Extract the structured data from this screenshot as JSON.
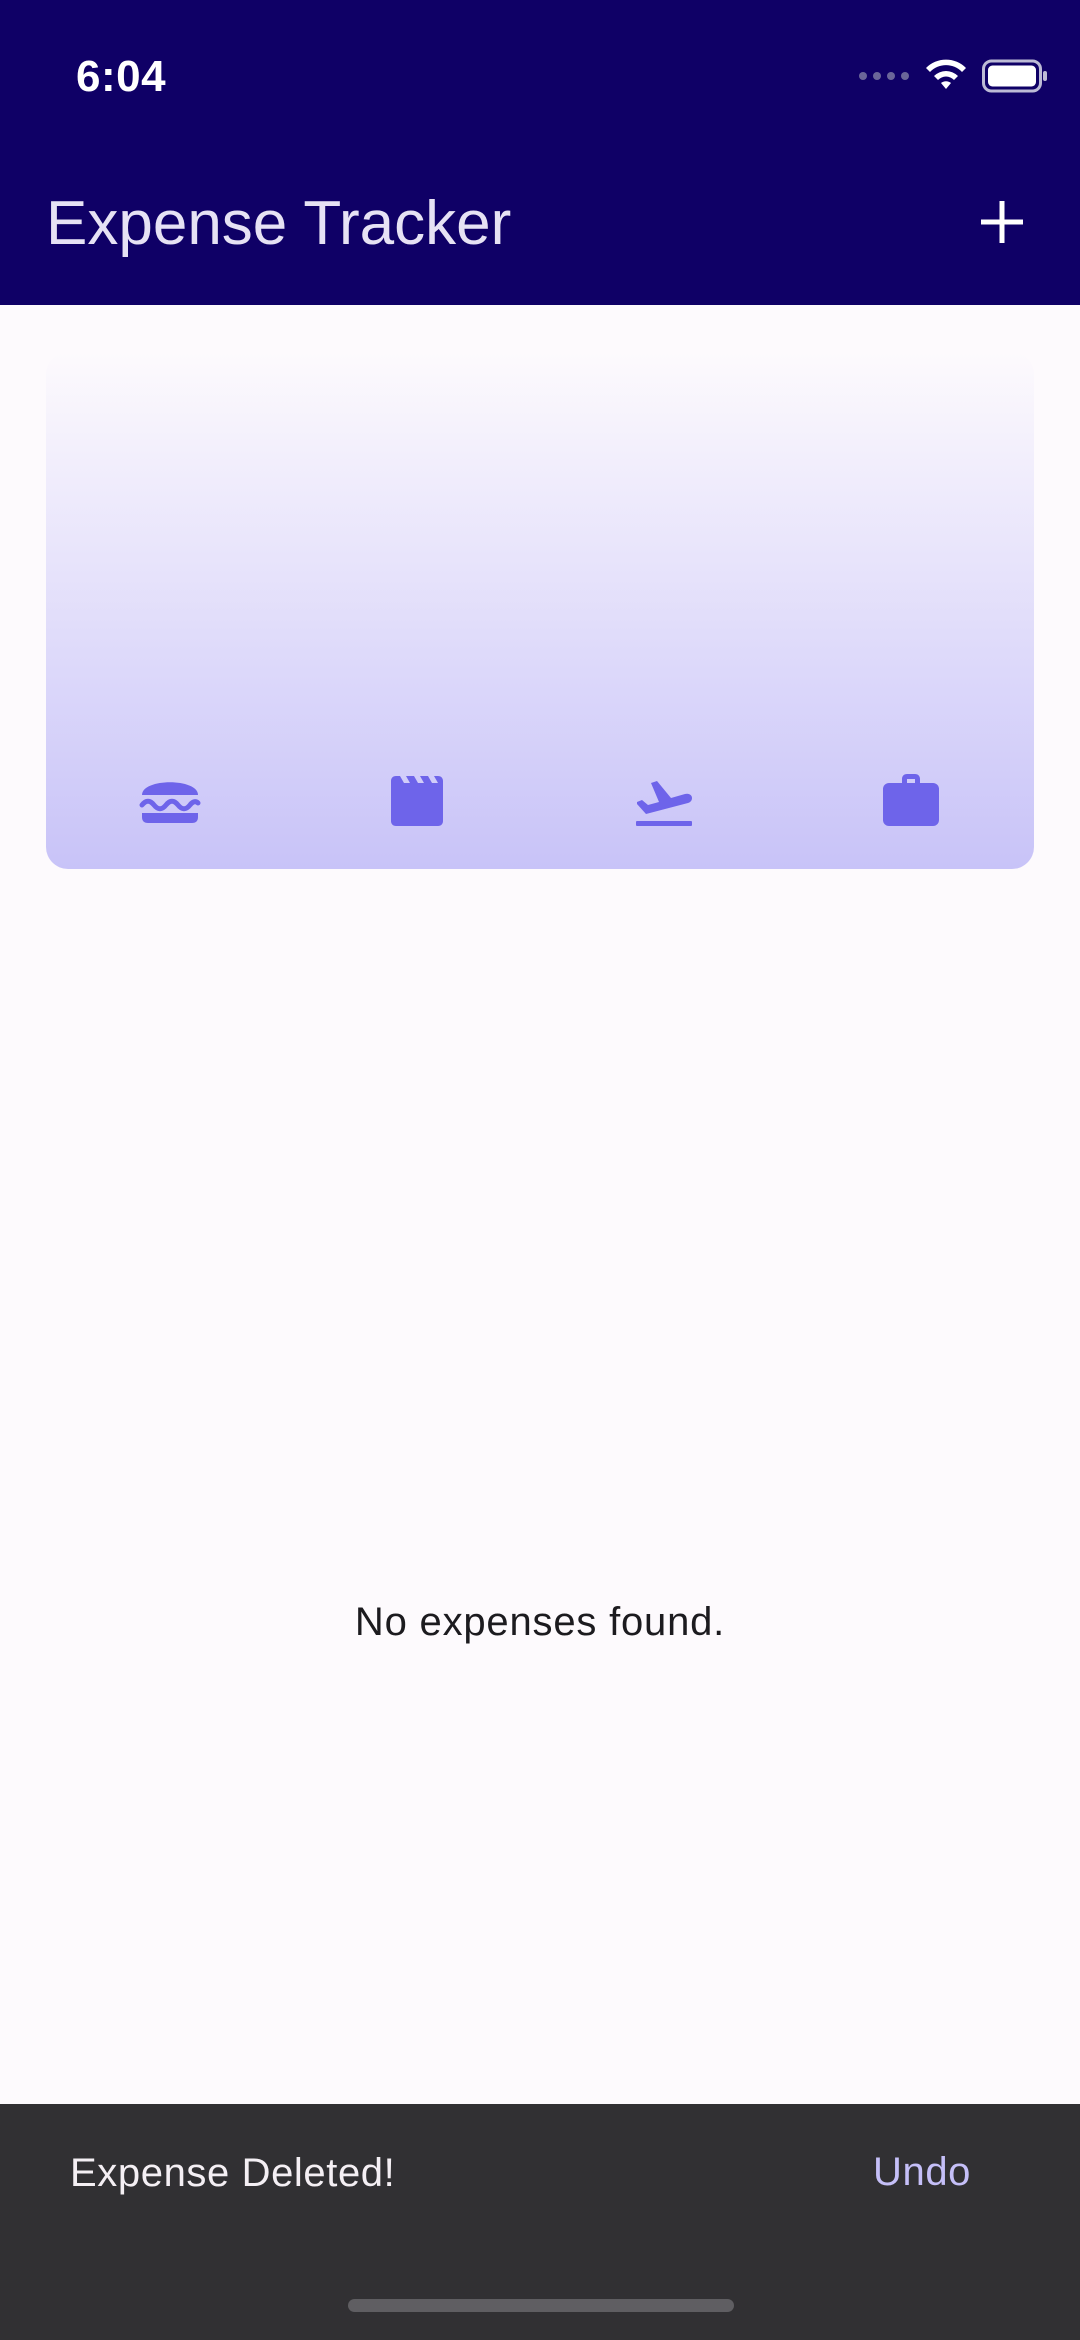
{
  "status_bar": {
    "time": "6:04",
    "icons": [
      "cellular-signal-icon",
      "wifi-icon",
      "battery-icon"
    ]
  },
  "app_bar": {
    "title": "Expense Tracker",
    "action_icon": "add-icon"
  },
  "chart": {
    "categories": [
      "food",
      "leisure",
      "travel",
      "work"
    ],
    "category_icons": [
      "burger-icon",
      "movie-clapper-icon",
      "flight-takeoff-icon",
      "briefcase-icon"
    ],
    "bar_fill_fraction": [
      0,
      0,
      0,
      0
    ]
  },
  "content": {
    "empty_message": "No expenses found."
  },
  "snackbar": {
    "message": "Expense Deleted!",
    "action_label": "Undo"
  },
  "colors": {
    "app_bar": "#0f0066",
    "background": "#fdfafd",
    "chart_gradient_end": "#c8c3f8",
    "icon_accent": "#6e64ea",
    "snackbar": "#313033",
    "snackbar_action": "#c5bff8"
  }
}
